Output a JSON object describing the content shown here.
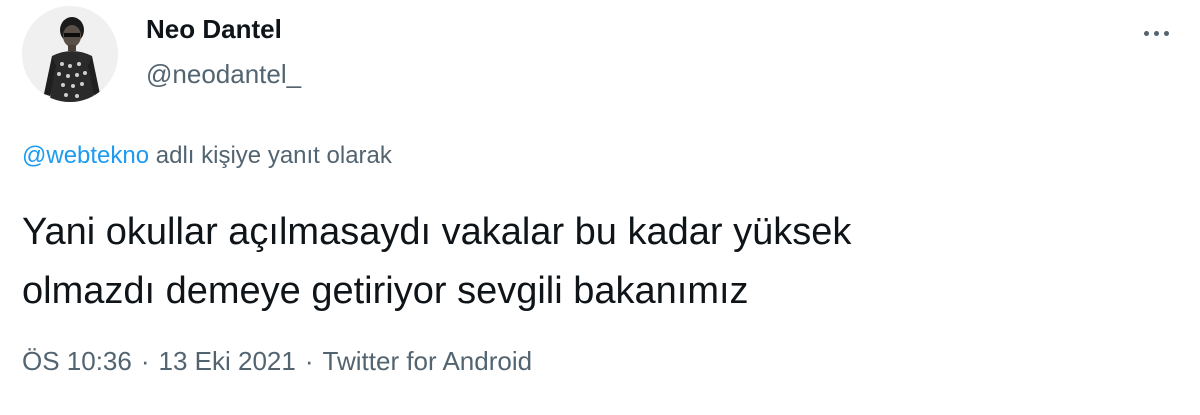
{
  "author": {
    "display_name": "Neo Dantel",
    "handle": "@neodantel_",
    "avatar_icon": "profile-photo"
  },
  "menu": {
    "icon": "more-horizontal-icon"
  },
  "reply_context": {
    "mention": "@webtekno",
    "suffix": " adlı kişiye yanıt olarak"
  },
  "tweet": {
    "text": "Yani okullar açılmasaydı vakalar bu kadar yüksek\nolmazdı demeye getiriyor sevgili bakanımız"
  },
  "meta": {
    "time": "ÖS 10:36",
    "date": "13 Eki 2021",
    "source": "Twitter for Android",
    "separator": "·"
  },
  "colors": {
    "accent": "#1d9bf0",
    "text": "#0f1419",
    "muted": "#536471",
    "background": "#ffffff"
  }
}
